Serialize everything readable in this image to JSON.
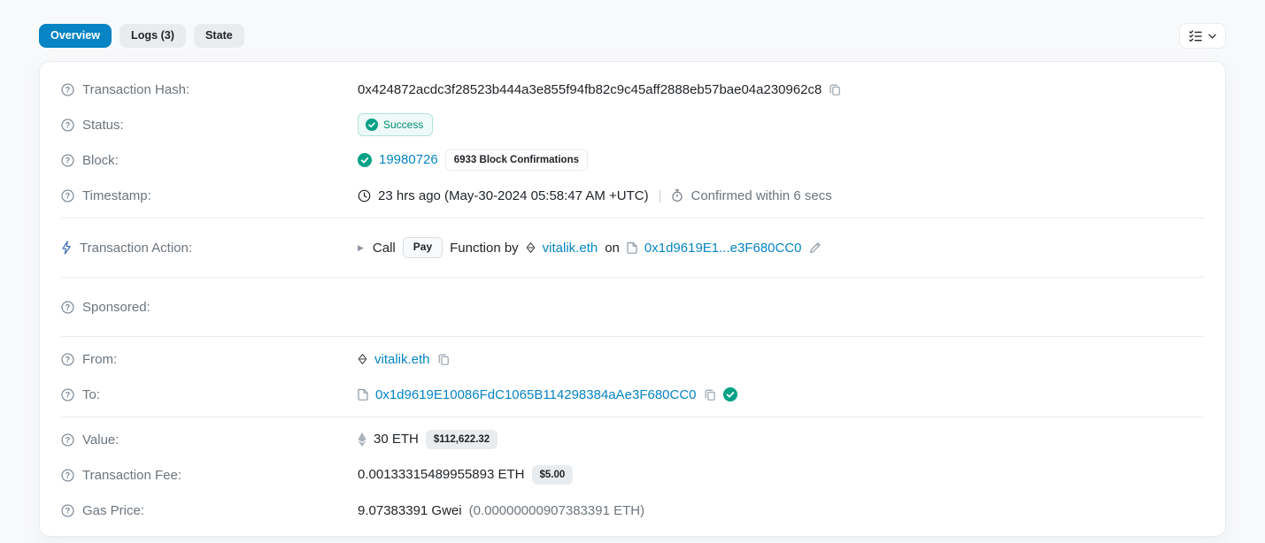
{
  "tabs": [
    {
      "label": "Overview",
      "active": true
    },
    {
      "label": "Logs (3)",
      "active": false
    },
    {
      "label": "State",
      "active": false
    }
  ],
  "rows": {
    "transaction_hash": {
      "label": "Transaction Hash:",
      "value": "0x424872acdc3f28523b444a3e855f94fb82c9c45aff2888eb57bae04a230962c8"
    },
    "status": {
      "label": "Status:",
      "badge": "Success"
    },
    "block": {
      "label": "Block:",
      "number": "19980726",
      "confirmations": "6933 Block Confirmations"
    },
    "timestamp": {
      "label": "Timestamp:",
      "value": "23 hrs ago (May-30-2024 05:58:47 AM +UTC)",
      "separator": "|",
      "confirmed": "Confirmed within 6 secs"
    },
    "action": {
      "label": "Transaction Action:",
      "call_text": "Call",
      "method": "Pay",
      "function_by": "Function by",
      "sender": "vitalik.eth",
      "on_text": "on",
      "contract_short": "0x1d9619E1...e3F680CC0"
    },
    "sponsored": {
      "label": "Sponsored:"
    },
    "from": {
      "label": "From:",
      "value": "vitalik.eth"
    },
    "to": {
      "label": "To:",
      "value": "0x1d9619E10086FdC1065B114298384aAe3F680CC0"
    },
    "value": {
      "label": "Value:",
      "amount": "30 ETH",
      "usd": "$112,622.32"
    },
    "fee": {
      "label": "Transaction Fee:",
      "amount": "0.00133315489955893 ETH",
      "usd": "$5.00"
    },
    "gas_price": {
      "label": "Gas Price:",
      "gwei": "9.07383391 Gwei",
      "eth": "(0.00000000907383391 ETH)"
    }
  },
  "icons": {
    "help": "?",
    "caret_right": "▶",
    "bolt": "lightning-bolt",
    "clock": "clock",
    "stopwatch": "stopwatch",
    "eth_diamond": "ethereum-diamond",
    "document": "contract-document",
    "copy": "copy",
    "check_circle": "check-circle",
    "pencil": "edit-pencil",
    "list_check": "display-options",
    "chevron_down": "chevron-down"
  },
  "colors": {
    "accent_blue": "#0784c3",
    "link_blue": "#0784c3",
    "success_green": "#00a186",
    "success_badge_bg": "#eefaf7",
    "badge_gray_bg": "#e9ecef",
    "label_gray": "#6c757d",
    "text_dark": "#212529",
    "page_bg": "#f8f9fa",
    "card_border": "#e9ecef"
  }
}
